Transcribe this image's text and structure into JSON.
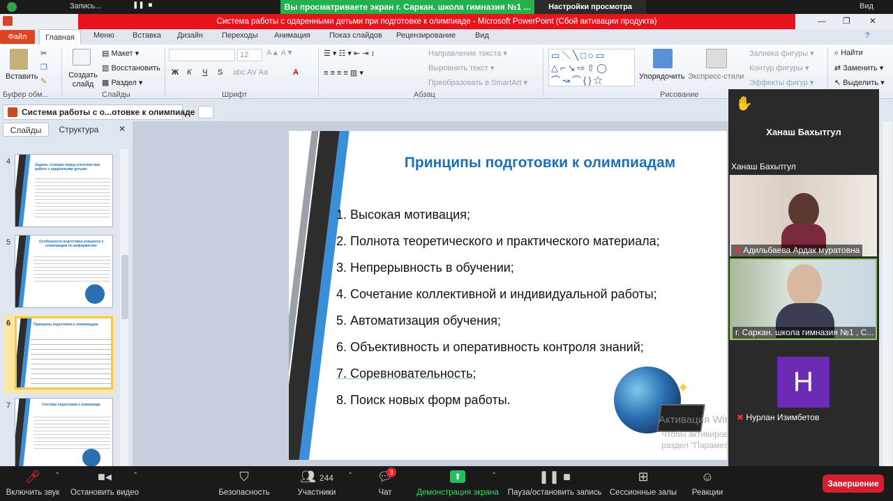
{
  "zoom_top": {
    "rec_label": "Запись...",
    "banner": "Вы просматриваете экран г. Саркан. школа гимназия №1 ...",
    "view_options": "Настройки просмотра",
    "view_right": "Вид"
  },
  "window": {
    "title": "Система работы с одаренными детьми при подготовке к олимпиаде  -  Microsoft PowerPoint (Сбой активации продукта)"
  },
  "menu": {
    "file": "Файл",
    "tabs": [
      "Главная",
      "Меню",
      "Вставка",
      "Дизайн",
      "Переходы",
      "Анимация",
      "Показ слайдов",
      "Рецензирование",
      "Вид"
    ]
  },
  "ribbon": {
    "paste": "Вставить",
    "clipboard": "Буфер обм...",
    "create_slide": "Создать слайд",
    "layout": "Макет",
    "restore": "Восстановить",
    "section": "Раздел",
    "slides_group": "Слайды",
    "font_size": "12",
    "font_group": "Шрифт",
    "paragraph_group": "Абзац",
    "text_dir": "Направление текста",
    "align_text": "Выровнять текст",
    "smartart": "Преобразовать в SmartArt",
    "arrange": "Упорядочить",
    "quick_styles": "Экспресс-стили",
    "drawing_group": "Рисование",
    "fill": "Заливка фигуры",
    "outline": "Контур фигуры",
    "effects": "Эффекты фигур",
    "find": "Найти",
    "replace": "Заменить",
    "select": "Выделить"
  },
  "doc_tab": "Система работы с о...отовке к олимпиаде",
  "pane": {
    "tab_slides": "Слайды",
    "tab_outline": "Структура"
  },
  "thumbs": [
    {
      "num": "4",
      "title": "Задачи, стоящие перед учителем при работе с одаренными детьми:"
    },
    {
      "num": "5",
      "title": "Особенности подготовки учащихся к олимпиадам по информатике"
    },
    {
      "num": "6",
      "title": "Принципы подготовки к олимпиадам"
    },
    {
      "num": "7",
      "title": "Система подготовки к олимпиаде"
    }
  ],
  "slide": {
    "title": "Принципы подготовки к олимпиадам",
    "items": [
      "1. Высокая мотивация;",
      "2. Полнота  теоретического и практического материала;",
      "3. Непрерывность в обучении;",
      "4. Сочетание коллективной и индивидуальной работы;",
      "5. Автоматизация обучения;",
      "6. Объективность и  оперативность контроля знаний;",
      "7. Соревновательность;",
      "8. Поиск новых форм работы."
    ]
  },
  "activation": {
    "line1": "Активация Windows",
    "line2": "Чтобы активировать Windows, перейдите в",
    "line3": "раздел \"Параметры\"."
  },
  "participants": {
    "host_big": "Ханаш Бахытгул",
    "host_small": "Ханаш Бахытгул",
    "video1_name": "Адильбаева Ардак муратовна",
    "video2_name": "г. Саркан. школа гимназия №1 , С...",
    "avatar_letter": "Н",
    "avatar_name": "Нурлан Изимбетов"
  },
  "toolbar": {
    "mute": "Включить звук",
    "video": "Остановить видео",
    "security": "Безопасность",
    "participants": "Участники",
    "participants_count": "244",
    "chat": "Чат",
    "chat_badge": "3",
    "share": "Демонстрация экрана",
    "pause_rec": "Пауза/остановить запись",
    "rooms": "Сессионные залы",
    "reactions": "Реакции",
    "end": "Завершение"
  }
}
